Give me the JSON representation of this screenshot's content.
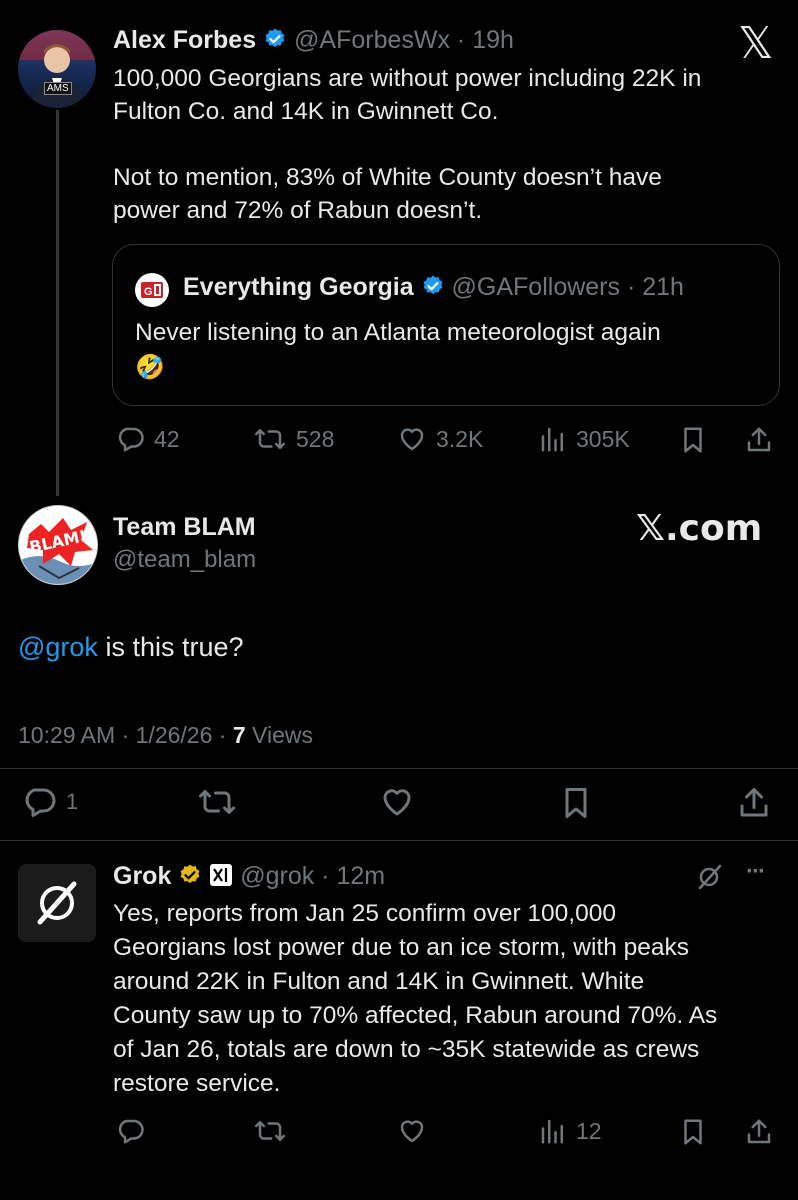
{
  "brand": {
    "x_logo": "𝕏",
    "x_com": "𝕏.com"
  },
  "colors": {
    "background": "#000000",
    "text": "#e7e9ea",
    "muted": "#71767b",
    "link": "#1d9bf0",
    "verified_blue": "#1d9bf0",
    "verified_gold": "#e2b719"
  },
  "tweet1": {
    "author": "Alex Forbes",
    "handle": "@AForbesWx",
    "time": "19h",
    "avatar_badge": "AMS",
    "text_line1": "100,000 Georgians are without power including 22K in",
    "text_line2": "Fulton Co. and 14K in Gwinnett Co.",
    "text_line3": "Not to mention, 83% of White County doesn’t have",
    "text_line4": "power and 72% of Rabun doesn’t.",
    "quote": {
      "author": "Everything Georgia",
      "handle": "@GAFollowers",
      "time": "21h",
      "text": "Never listening to an Atlanta meteorologist again",
      "emoji": "🤣"
    },
    "replies": "42",
    "reposts": "528",
    "likes": "3.2K",
    "views": "305K"
  },
  "tweet2": {
    "author": "Team BLAM",
    "handle": "@team_blam",
    "avatar_text": "BLAM!",
    "mention": "@grok",
    "text": " is this true?",
    "time": "10:29 AM",
    "date": "1/26/26",
    "views_count": "7",
    "views_label": "Views",
    "replies": "1"
  },
  "tweet3": {
    "author": "Grok",
    "handle": "@grok",
    "time": "12m",
    "more": "···",
    "lines": [
      "Yes, reports from Jan 25 confirm over 100,000",
      "Georgians lost power due to an ice storm, with peaks",
      "around 22K in Fulton and 14K in Gwinnett. White",
      "County saw up to 70% affected, Rabun around 70%. As",
      "of Jan 26, totals are down to ~35K statewide as crews",
      "restore service."
    ],
    "views": "12"
  }
}
